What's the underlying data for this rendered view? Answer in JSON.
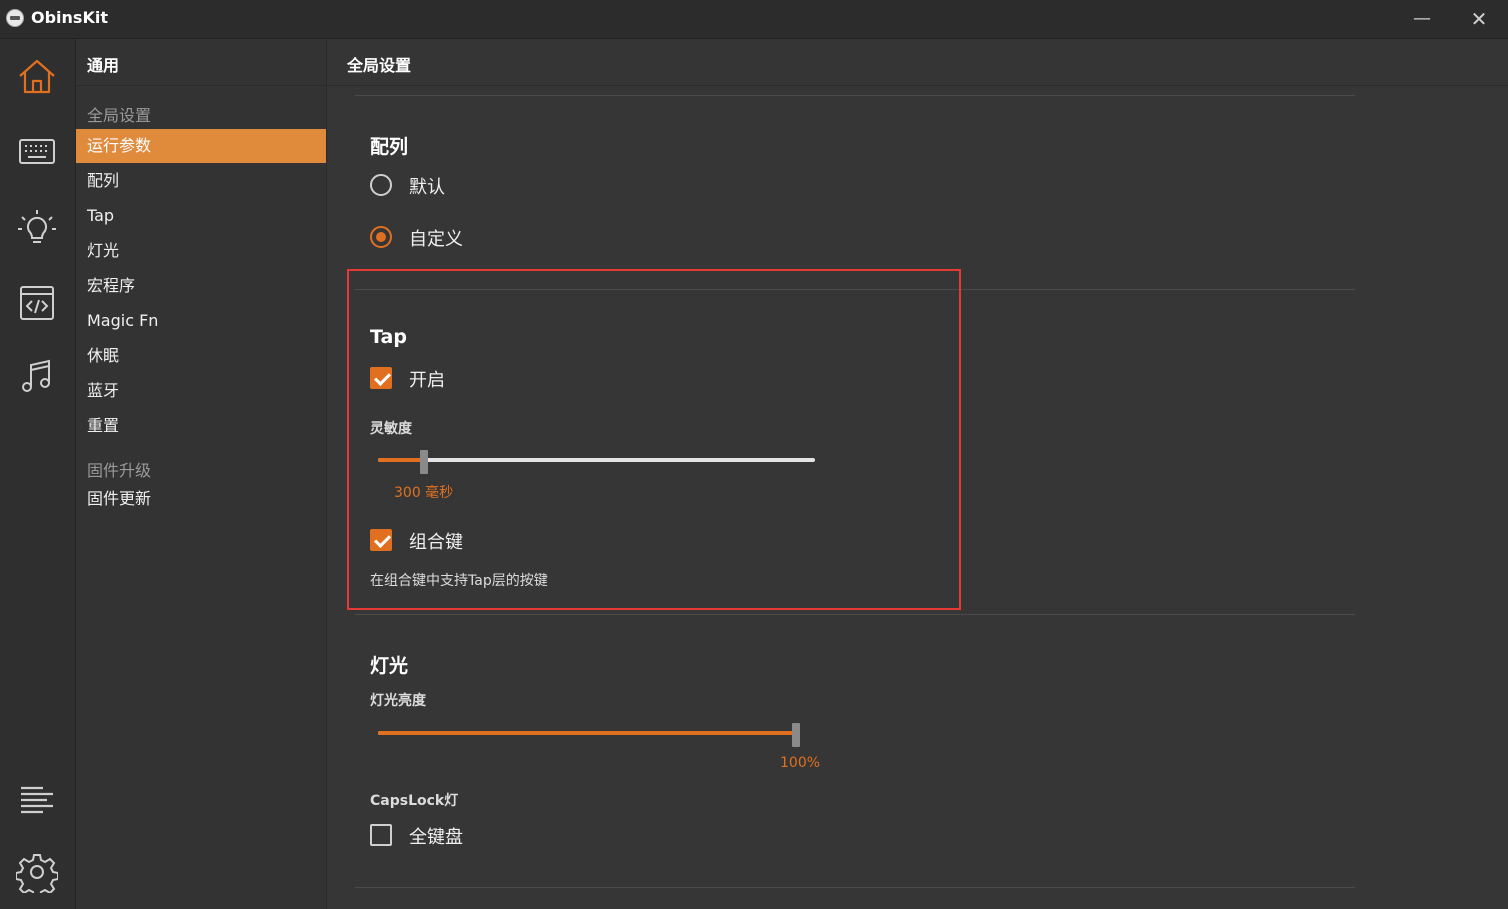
{
  "window": {
    "title": "ObinsKit",
    "minimize": "—",
    "close": "✕"
  },
  "iconbar": {
    "items": [
      "home-icon",
      "keyboard-icon",
      "lightbulb-icon",
      "code-icon",
      "music-icon"
    ],
    "bottom": [
      "list-icon",
      "gear-icon"
    ],
    "accent": "#e07020"
  },
  "sidebar": {
    "title": "通用",
    "sections": [
      {
        "label": "全局设置",
        "items": [
          "运行参数",
          "配列",
          "Tap",
          "灯光",
          "宏程序",
          "Magic Fn",
          "休眠",
          "蓝牙",
          "重置"
        ]
      },
      {
        "label": "固件升级",
        "items": [
          "固件更新"
        ]
      }
    ],
    "active_item": "运行参数"
  },
  "main": {
    "title": "全局设置",
    "layout": {
      "title": "配列",
      "options": [
        {
          "label": "默认",
          "checked": false
        },
        {
          "label": "自定义",
          "checked": true
        }
      ]
    },
    "tap": {
      "title": "Tap",
      "enable_label": "开启",
      "enable_checked": true,
      "sensitivity_label": "灵敏度",
      "sensitivity_value_text": "300 毫秒",
      "sensitivity_fraction": 0.106,
      "combo_label": "组合键",
      "combo_checked": true,
      "combo_hint": "在组合键中支持Tap层的按键"
    },
    "lighting": {
      "title": "灯光",
      "brightness_label": "灯光亮度",
      "brightness_value_text": "100%",
      "brightness_fraction": 1.0,
      "capslock_label": "CapsLock灯",
      "full_keyboard_label": "全键盘",
      "full_keyboard_checked": false
    }
  },
  "colors": {
    "accent": "#e07020",
    "highlight_border": "#e53935",
    "active_menu": "#e08a3c"
  }
}
